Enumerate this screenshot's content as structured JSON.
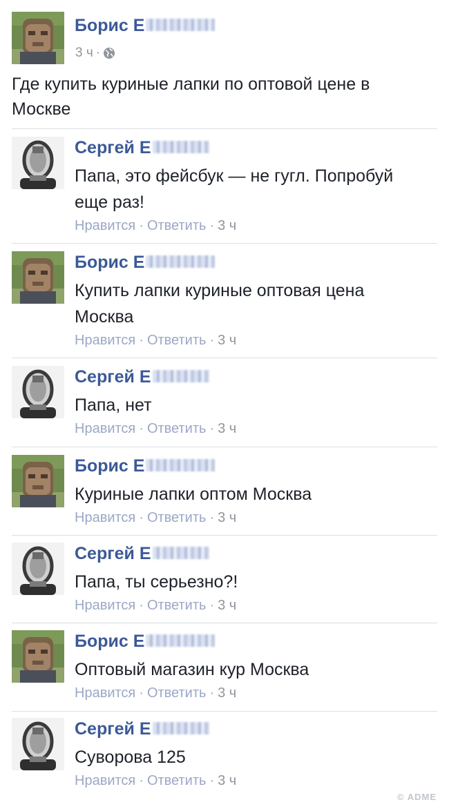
{
  "post": {
    "author": "Борис Е",
    "time": "3 ч",
    "separator": "·",
    "privacy_icon": "globe-icon",
    "text": "Где купить куриные лапки по оптовой цене в Москве"
  },
  "actions": {
    "like": "Нравится",
    "reply": "Ответить",
    "dot": "·"
  },
  "comments": [
    {
      "author": "Сергей Е",
      "avatar": "default-avatar",
      "text": "Папа, это фейсбук — не гугл. Попробуй еще раз!",
      "time": "3 ч"
    },
    {
      "author": "Борис Е",
      "avatar": "photo-avatar",
      "text": "Купить лапки куриные оптовая цена Москва",
      "time": "3 ч"
    },
    {
      "author": "Сергей Е",
      "avatar": "default-avatar",
      "text": "Папа, нет",
      "time": "3 ч"
    },
    {
      "author": "Борис Е",
      "avatar": "photo-avatar",
      "text": "Куриные лапки оптом Москва",
      "time": "3 ч"
    },
    {
      "author": "Сергей Е",
      "avatar": "default-avatar",
      "text": "Папа, ты серьезно?!",
      "time": "3 ч"
    },
    {
      "author": "Борис Е",
      "avatar": "photo-avatar",
      "text": "Оптовый магазин кур Москва",
      "time": "3 ч"
    },
    {
      "author": "Сергей Е",
      "avatar": "default-avatar",
      "text": "Суворова 125",
      "time": "3 ч"
    }
  ],
  "watermark": "© ADME",
  "colors": {
    "name": "#3b5998",
    "text": "#1d2129",
    "meta": "#90949c",
    "divider": "#dcdee3"
  }
}
